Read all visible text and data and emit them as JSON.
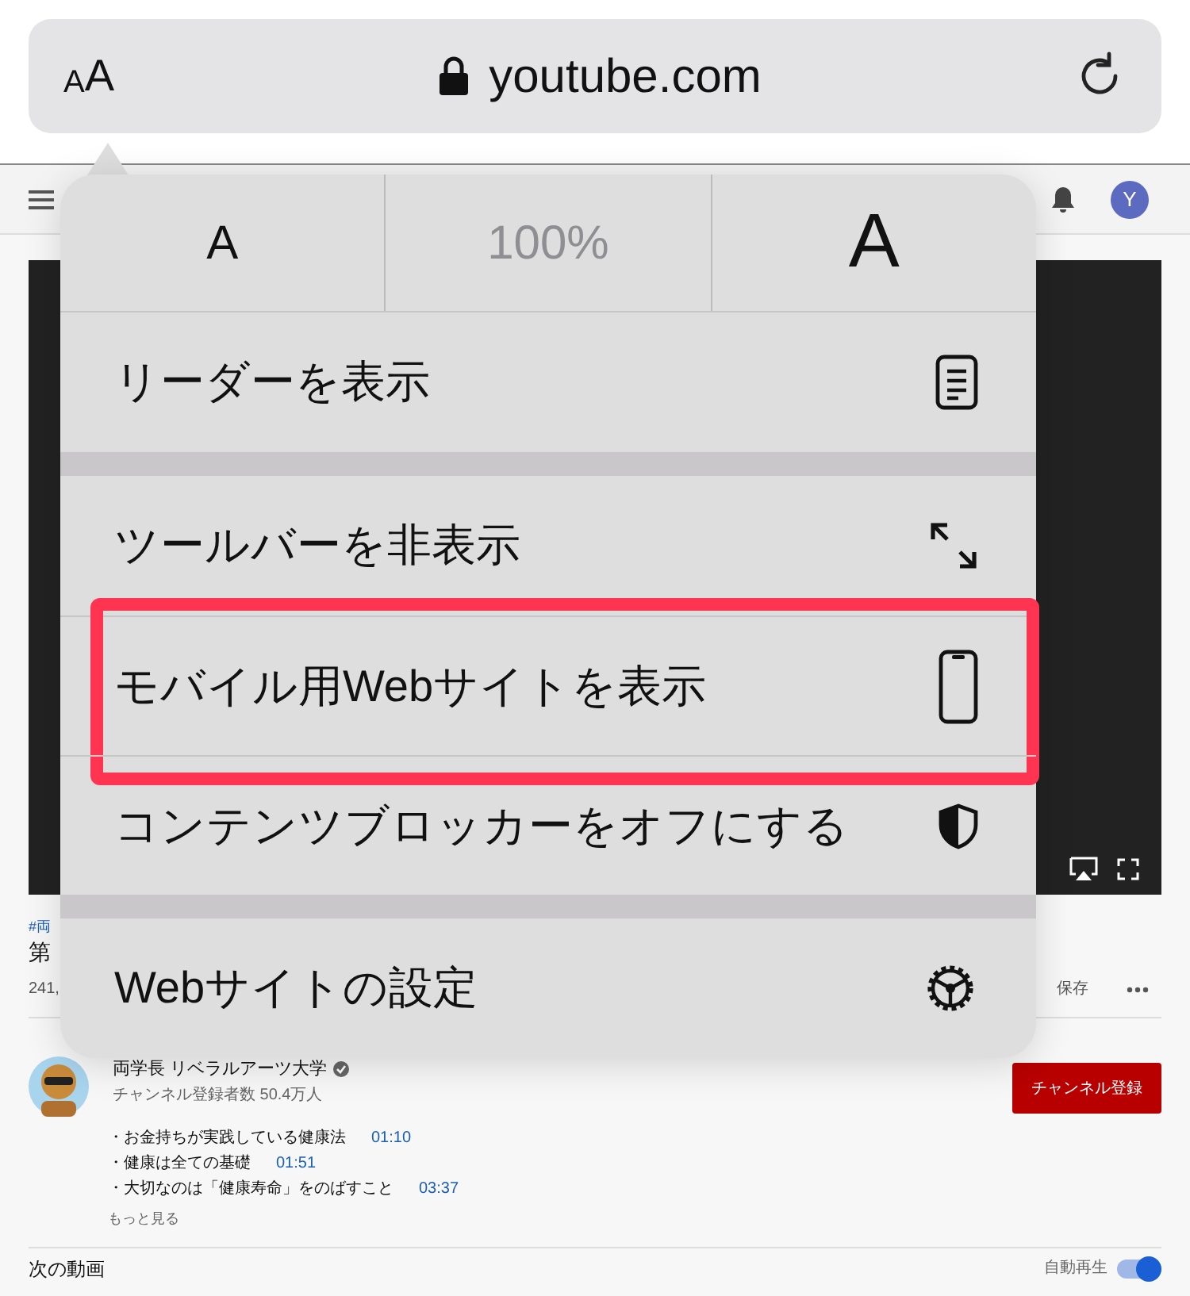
{
  "address_bar": {
    "format_label": "AA",
    "domain": "youtube.com"
  },
  "page": {
    "header": {
      "avatar": "Y"
    },
    "video_hashtag": "#両",
    "video_title": "第",
    "video_stats": "241,",
    "save_label": "保存",
    "channel": {
      "name": "両学長 リベラルアーツ大学",
      "verified": true,
      "subscribers": "チャンネル登録者数 50.4万人"
    },
    "subscribe_button": "チャンネル登録",
    "chapters": [
      {
        "text": "・お金持ちが実践している健康法",
        "time": "01:10"
      },
      {
        "text": "・健康は全ての基礎",
        "time": "01:51"
      },
      {
        "text": "・大切なのは「健康寿命」をのばすこと",
        "time": "03:37"
      }
    ],
    "show_more": "もっと見る",
    "up_next": "次の動画",
    "autoplay": {
      "label": "自動再生",
      "on": true
    }
  },
  "menu": {
    "font_size": {
      "smaller": "A",
      "zoom": "100%",
      "larger": "A"
    },
    "groups": [
      [
        {
          "label": "リーダーを表示",
          "kind": "reader",
          "highlighted": false
        }
      ],
      [
        {
          "label": "ツールバーを非表示",
          "kind": "expand",
          "highlighted": false
        },
        {
          "label": "モバイル用Webサイトを表示",
          "kind": "phone",
          "highlighted": true
        },
        {
          "label": "コンテンツブロッカーをオフにする",
          "kind": "shield",
          "highlighted": false
        }
      ],
      [
        {
          "label": "Webサイトの設定",
          "kind": "gear",
          "highlighted": false
        }
      ]
    ]
  }
}
